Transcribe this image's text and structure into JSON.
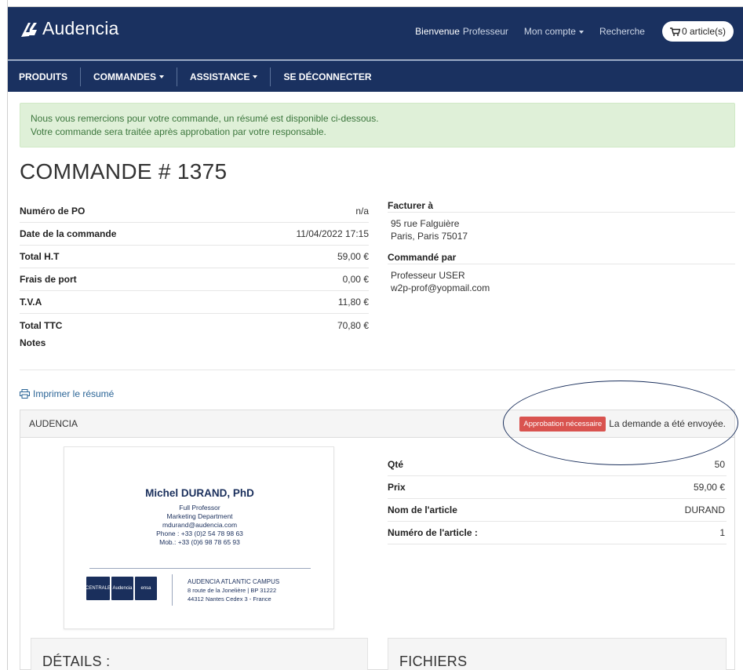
{
  "brand": {
    "name": "Audencia",
    "color": "#1a3160"
  },
  "topnav": {
    "welcome_label": "Bienvenue",
    "user": "Professeur",
    "account": "Mon compte",
    "search": "Recherche",
    "cart": "0 article(s)"
  },
  "menu": [
    "PRODUITS",
    "COMMANDES",
    "ASSISTANCE",
    "SE DÉCONNECTER"
  ],
  "alert": {
    "line1": "Nous vous remercions pour votre commande, un résumé est disponible ci-dessous.",
    "line2": "Votre commande sera traitée après approbation par votre responsable."
  },
  "order": {
    "title": "COMMANDE # 1375",
    "rows": [
      {
        "label": "Numéro de PO",
        "value": "n/a"
      },
      {
        "label": "Date de la commande",
        "value": "11/04/2022 17:15"
      },
      {
        "label": "Total H.T",
        "value": "59,00 €"
      },
      {
        "label": "Frais de port",
        "value": "0,00 €"
      },
      {
        "label": "T.V.A",
        "value": "11,80 €"
      },
      {
        "label": "Total TTC",
        "value": "70,80 €"
      },
      {
        "label": "Notes",
        "value": ""
      }
    ]
  },
  "billing": {
    "bill_title": "Facturer à",
    "bill_line1": "95 rue Falguière",
    "bill_line2": "Paris, Paris 75017",
    "ordered_title": "Commandé par",
    "ordered_line1": "Professeur USER",
    "ordered_line2": "w2p-prof@yopmail.com"
  },
  "print_label": "Imprimer le résumé",
  "panel": {
    "name": "AUDENCIA",
    "badge": "Approbation nécessaire",
    "badge_color": "#d9534f",
    "status": "La demande a été envoyée."
  },
  "card": {
    "name": "Michel DURAND, PhD",
    "lines": [
      "Full Professor",
      "Marketing Department",
      "mdurand@audencia.com",
      "Phone : +33 (0)2 54 78 98 63",
      "Mob.: +33 (0)6 98 78 65 93"
    ],
    "logos": [
      "CENTRALE",
      "Audencia",
      "ensa"
    ],
    "addr_title": "AUDENCIA ATLANTIC CAMPUS",
    "addr_line1": "8 route de la Jonelière | BP 31222",
    "addr_line2": "44312 Nantes Cedex 3 - France"
  },
  "item": {
    "rows": [
      {
        "label": "Qté",
        "value": "50"
      },
      {
        "label": "Prix",
        "value": "59,00 €"
      },
      {
        "label": "Nom de l'article",
        "value": "DURAND"
      },
      {
        "label": "Numéro de l'article :",
        "value": "1"
      }
    ]
  },
  "sections": {
    "details": "DÉTAILS :",
    "files": "FICHIERS"
  }
}
